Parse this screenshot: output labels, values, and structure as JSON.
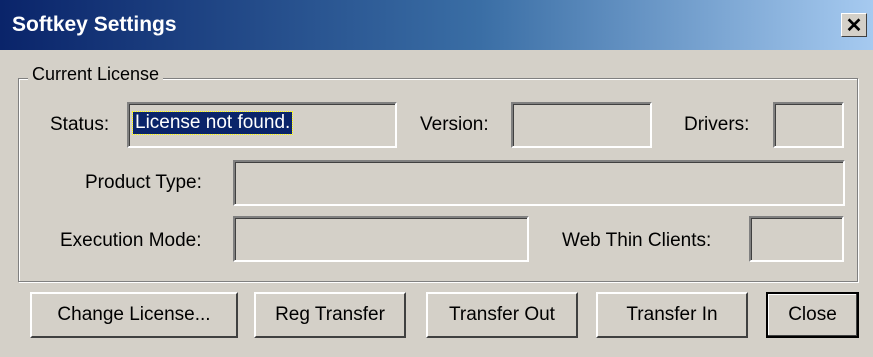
{
  "window": {
    "title": "Softkey Settings",
    "close_glyph": "✕"
  },
  "group": {
    "legend": "Current License"
  },
  "labels": {
    "status": "Status:",
    "version": "Version:",
    "drivers": "Drivers:",
    "product_type": "Product Type:",
    "execution_mode": "Execution Mode:",
    "web_thin_clients": "Web Thin Clients:"
  },
  "fields": {
    "status": "License not found.",
    "version": "",
    "drivers": "",
    "product_type": "",
    "execution_mode": "",
    "web_thin_clients": ""
  },
  "buttons": {
    "change_license": "Change License...",
    "reg_transfer": "Reg Transfer",
    "transfer_out": "Transfer Out",
    "transfer_in": "Transfer In",
    "close": "Close"
  },
  "colors": {
    "titlebar_start": "#0a246a",
    "titlebar_end": "#a6caf0",
    "face": "#d4d0c8",
    "selection": "#0a246a"
  }
}
